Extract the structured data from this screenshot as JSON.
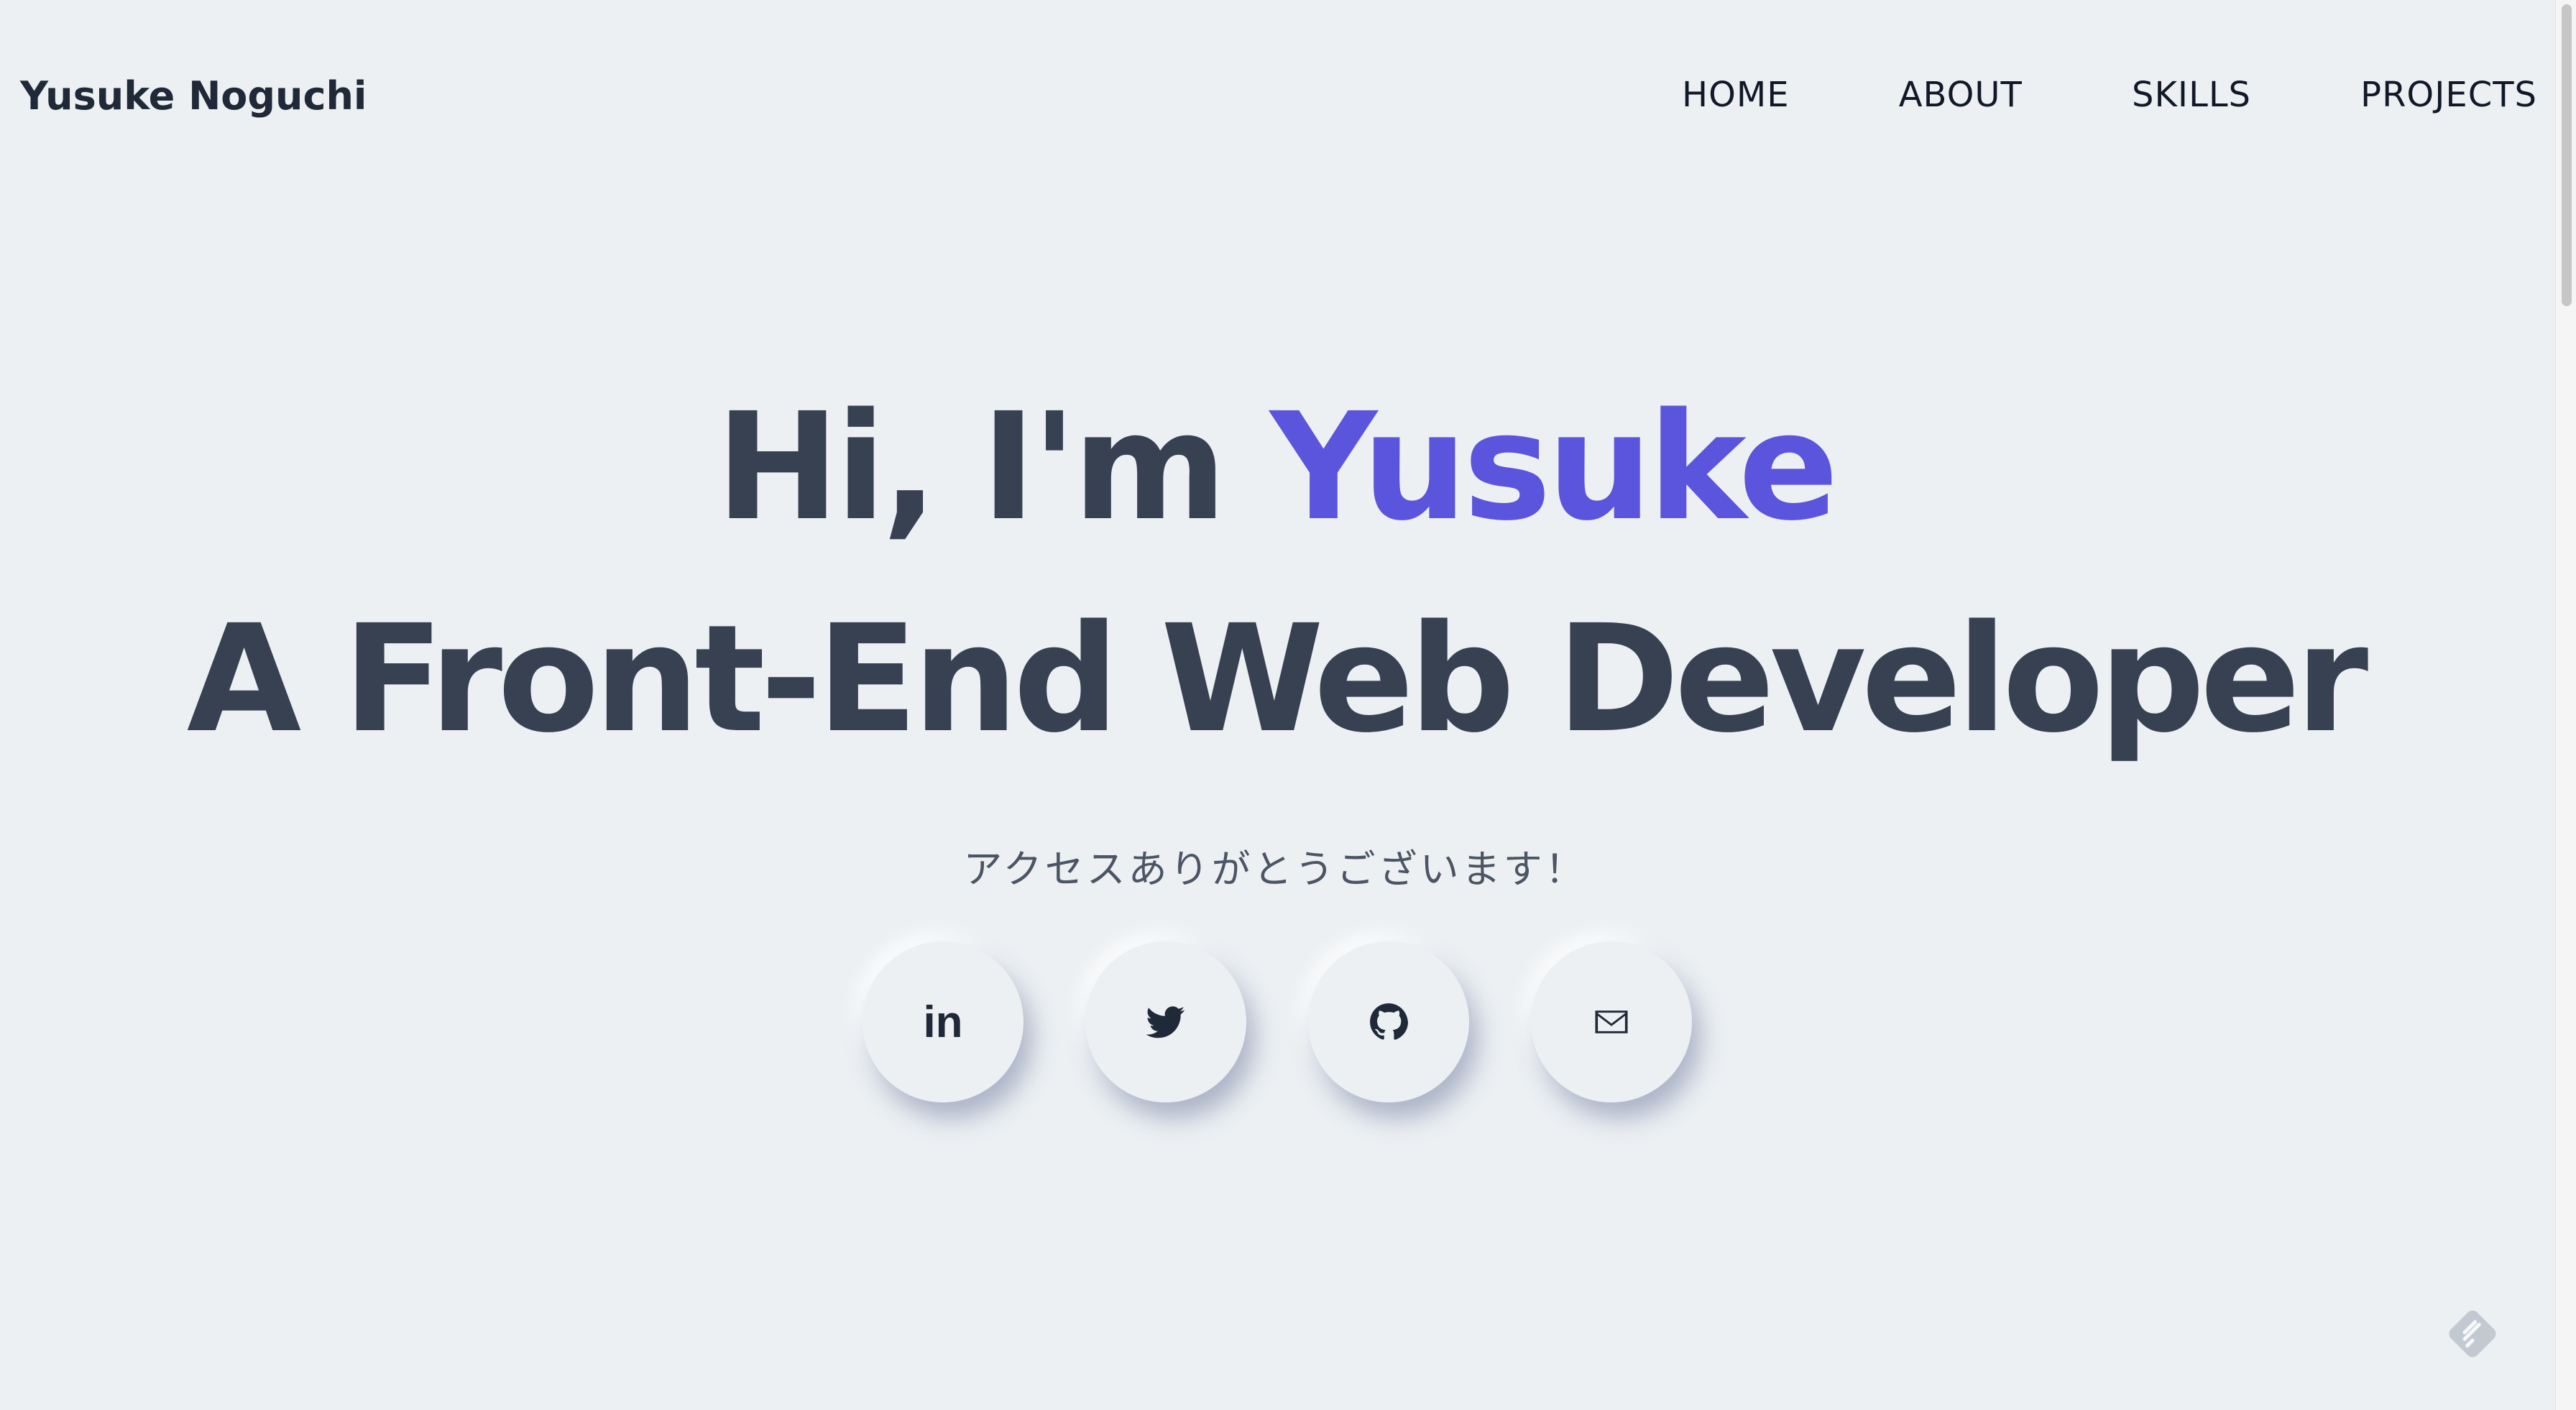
{
  "header": {
    "brand": "Yusuke Noguchi",
    "nav": [
      {
        "label": "HOME"
      },
      {
        "label": "ABOUT"
      },
      {
        "label": "SKILLS"
      },
      {
        "label": "PROJECTS"
      }
    ]
  },
  "hero": {
    "greeting_prefix": "Hi, I'm ",
    "greeting_name": "Yusuke",
    "role": "A Front-End Web Developer",
    "subtitle": "アクセスありがとうございます！",
    "linkedin_glyph": "in"
  },
  "socials": [
    {
      "icon": "linkedin-icon"
    },
    {
      "icon": "twitter-icon"
    },
    {
      "icon": "github-icon"
    },
    {
      "icon": "mail-icon"
    }
  ],
  "colors": {
    "background": "#ecf0f3",
    "accent": "#5b55dd",
    "heading": "#374151",
    "text": "#1f2937"
  }
}
